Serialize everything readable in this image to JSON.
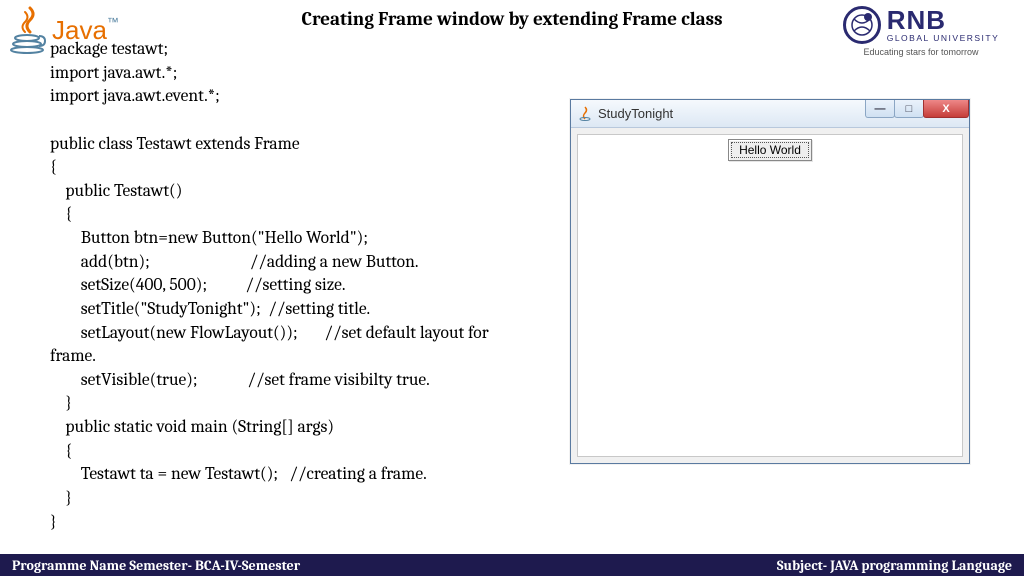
{
  "title": "Creating Frame window by extending Frame class",
  "javaLogo": {
    "text": "Java"
  },
  "rnb": {
    "name": "RNB",
    "sub": "GLOBAL UNIVERSITY",
    "tag": "Educating stars for tomorrow"
  },
  "code": "package testawt;\nimport java.awt.*;\nimport java.awt.event.*;\n\npublic class Testawt extends Frame\n{\n    public Testawt()\n    {\n        Button btn=new Button(\"Hello World\");\n        add(btn);                          //adding a new Button.\n        setSize(400, 500);          //setting size.\n        setTitle(\"StudyTonight\");  //setting title.\n        setLayout(new FlowLayout());       //set default layout for\nframe.\n        setVisible(true);             //set frame visibilty true.\n    }\n    public static void main (String[] args)\n    {\n        Testawt ta = new Testawt();   //creating a frame.\n    }\n}",
  "window": {
    "title": "StudyTonight",
    "minimize": "—",
    "maximize": "□",
    "close": "X",
    "button": "Hello World"
  },
  "footer": {
    "left": "Programme Name Semester- BCA-IV-Semester",
    "right": "Subject- JAVA programming Language"
  }
}
